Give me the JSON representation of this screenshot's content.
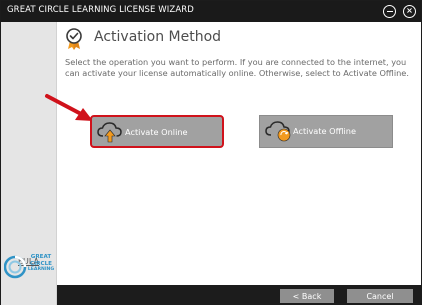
{
  "window": {
    "title": "GREAT CIRCLE LEARNING LICENSE WIZARD"
  },
  "header": {
    "title": "Activation Method",
    "instructions": "Select the operation you want to perform. If you are connected to the internet, you can activate your license automatically online. Otherwise, select to Activate Offline."
  },
  "options": {
    "online_label": "Activate Online",
    "offline_label": "Activate Offline"
  },
  "sidebar": {
    "eula_label": "EULA",
    "logo_lines": [
      "GREAT",
      "CIRCLE",
      "LEARNING"
    ]
  },
  "footer": {
    "back_label": "< Back",
    "cancel_label": "Cancel"
  },
  "colors": {
    "titlebar": "#1a1a1a",
    "highlight": "#d0121b",
    "button_gray": "#a1a1a1",
    "accent_orange": "#f29a1f",
    "brand_blue": "#2f93c6"
  },
  "icons": {
    "header": "medal-check-icon",
    "online": "cloud-upload-icon",
    "offline": "cloud-sync-icon",
    "pointer": "red-arrow-icon"
  }
}
